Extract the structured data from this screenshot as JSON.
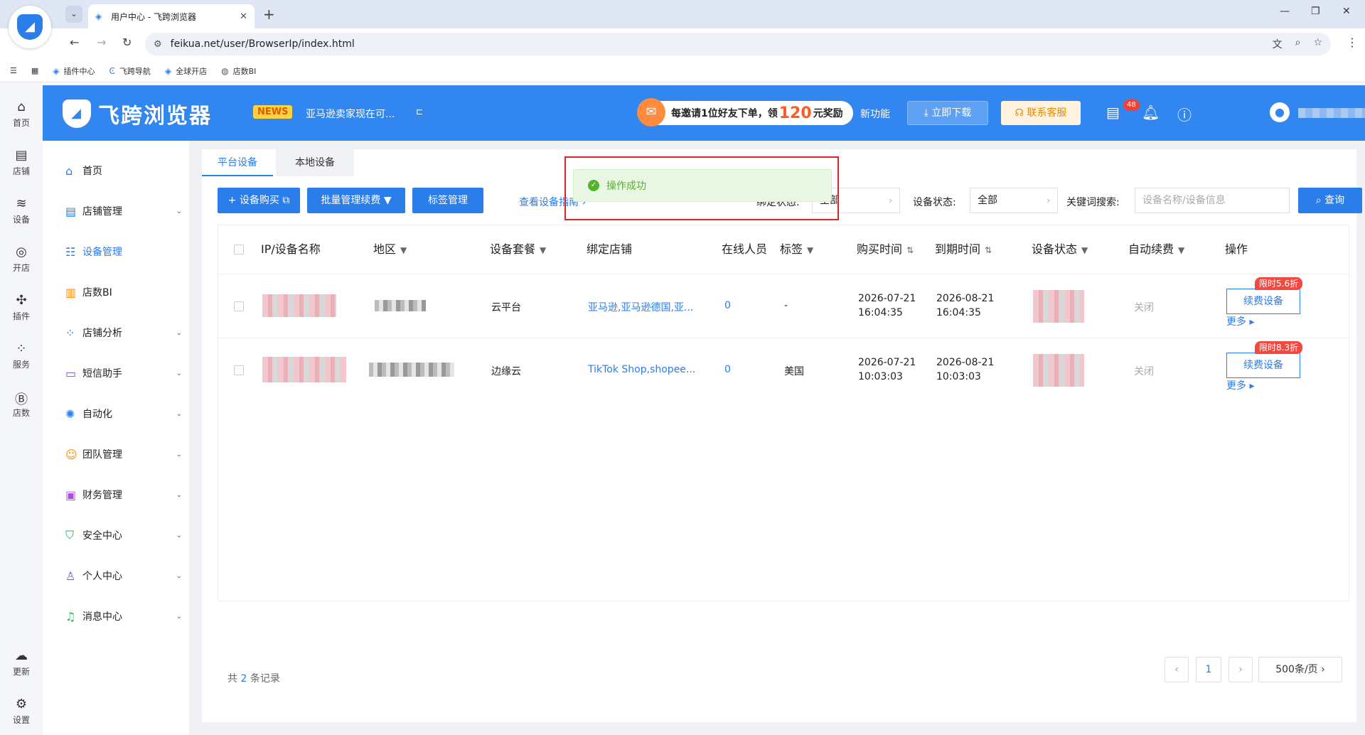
{
  "browser": {
    "tab_title": "用户中心 - 飞跨浏览器",
    "url": "feikua.net/user/BrowserIp/index.html",
    "bookmarks": [
      "插件中心",
      "飞跨导航",
      "全球开店",
      "店数BI"
    ]
  },
  "left_strip": [
    {
      "label": "首页",
      "icon": "home-icon"
    },
    {
      "label": "店铺",
      "icon": "store-icon"
    },
    {
      "label": "设备",
      "icon": "layers-icon"
    },
    {
      "label": "开店",
      "icon": "planet-icon"
    },
    {
      "label": "插件",
      "icon": "puzzle-icon"
    },
    {
      "label": "服务",
      "icon": "grid-icon"
    },
    {
      "label": "店数",
      "icon": "bi-icon"
    },
    {
      "label": "更新",
      "icon": "cloud-upload-icon"
    },
    {
      "label": "设置",
      "icon": "gear-icon"
    }
  ],
  "header": {
    "brand": "飞跨浏览器",
    "news_tag": "NEWS",
    "news_text": "亚马逊卖家现在可...",
    "invite_pre": "每邀请1位好友下单，领",
    "invite_amount": "120",
    "invite_post": "元奖励",
    "new_feature": "新功能",
    "download": "立即下载",
    "service": "联系客服",
    "notifications": "48"
  },
  "sidebar": [
    {
      "label": "首页",
      "icon": "home-icon",
      "expand": false
    },
    {
      "label": "店铺管理",
      "icon": "store-icon",
      "expand": true
    },
    {
      "label": "设备管理",
      "icon": "device-icon",
      "expand": false,
      "active": true
    },
    {
      "label": "店数BI",
      "icon": "bar-chart-icon",
      "expand": false
    },
    {
      "label": "店铺分析",
      "icon": "analysis-icon",
      "expand": true
    },
    {
      "label": "短信助手",
      "icon": "message-icon",
      "expand": true
    },
    {
      "label": "自动化",
      "icon": "automation-icon",
      "expand": true
    },
    {
      "label": "团队管理",
      "icon": "team-icon",
      "expand": true
    },
    {
      "label": "财务管理",
      "icon": "wallet-icon",
      "expand": true
    },
    {
      "label": "安全中心",
      "icon": "shield-icon",
      "expand": true
    },
    {
      "label": "个人中心",
      "icon": "user-icon",
      "expand": true
    },
    {
      "label": "消息中心",
      "icon": "bell-icon",
      "expand": true
    }
  ],
  "tabs": [
    "平台设备",
    "本地设备"
  ],
  "actions": {
    "buy": "设备购买",
    "batch": "批量管理续费",
    "tags": "标签管理",
    "guide": "查看设备指南"
  },
  "filters": {
    "bind_label": "绑定状态:",
    "bind_value": "全部",
    "status_label": "设备状态:",
    "status_value": "全部",
    "keyword_label": "关键词搜索:",
    "keyword_placeholder": "设备名称/设备信息",
    "query": "查询"
  },
  "table": {
    "columns": [
      "IP/设备名称",
      "地区",
      "设备套餐",
      "绑定店铺",
      "在线人员",
      "标签",
      "购买时间",
      "到期时间",
      "设备状态",
      "自动续费",
      "操作"
    ],
    "rows": [
      {
        "plan": "云平台",
        "shops": "亚马逊,亚马逊德国,亚...",
        "online": "0",
        "tag": "-",
        "buy_date": "2026-07-21",
        "buy_time": "16:04:35",
        "exp_date": "2026-08-21",
        "exp_time": "16:04:35",
        "auto": "关闭",
        "promo": "限时5.6折",
        "renew": "续费设备",
        "more": "更多"
      },
      {
        "plan": "边缘云",
        "shops": "TikTok Shop,shopee...",
        "online": "0",
        "tag": "美国",
        "buy_date": "2026-07-21",
        "buy_time": "10:03:03",
        "exp_date": "2026-08-21",
        "exp_time": "10:03:03",
        "auto": "关闭",
        "promo": "限时8.3折",
        "renew": "续费设备",
        "more": "更多"
      }
    ]
  },
  "pagination": {
    "total_pre": "共",
    "total": "2",
    "total_post": "条记录",
    "page": "1",
    "size": "500条/页"
  },
  "toast": "操作成功"
}
